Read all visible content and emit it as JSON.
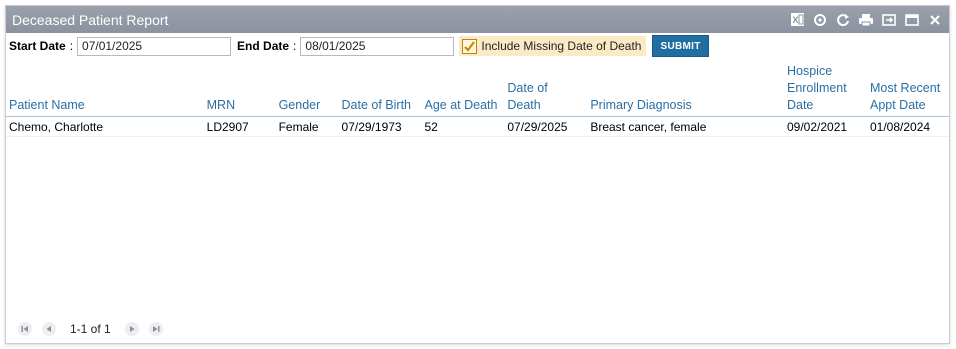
{
  "window": {
    "title": "Deceased Patient Report"
  },
  "toolbar_icons": [
    "excel-icon",
    "refresh-settings-icon",
    "refresh-icon",
    "print-icon",
    "export-icon",
    "maximize-icon",
    "close-icon"
  ],
  "filters": {
    "start_label": "Start Date",
    "start_sep": ":",
    "start_value": "07/01/2025",
    "end_label": "End Date",
    "end_sep": ":",
    "end_value": "08/01/2025",
    "include_missing_label": "Include Missing Date of Death",
    "include_missing_checked": true,
    "submit_label": "SUBMIT"
  },
  "table": {
    "columns": [
      {
        "key": "name",
        "label": "Patient Name"
      },
      {
        "key": "mrn",
        "label": "MRN"
      },
      {
        "key": "gender",
        "label": "Gender"
      },
      {
        "key": "dob",
        "label": "Date of Birth"
      },
      {
        "key": "age",
        "label": "Age at Death"
      },
      {
        "key": "dod",
        "label": "Date of Death"
      },
      {
        "key": "diag",
        "label": "Primary Diagnosis"
      },
      {
        "key": "hospice",
        "label": "Hospice Enrollment Date"
      },
      {
        "key": "appt",
        "label": "Most Recent Appt Date"
      }
    ],
    "rows": [
      {
        "name": "Chemo, Charlotte",
        "mrn": "LD2907",
        "gender": "Female",
        "dob": "07/29/1973",
        "age": "52",
        "dod": "07/29/2025",
        "diag": "Breast cancer, female",
        "hospice": "09/02/2021",
        "appt": "01/08/2024"
      }
    ]
  },
  "pager": {
    "info": "1-1 of 1"
  },
  "colors": {
    "titlebar": "#8f96a3",
    "header_text": "#2b6fa3",
    "submit": "#1f6fa3",
    "checkbox_bg": "#fbebc5"
  }
}
